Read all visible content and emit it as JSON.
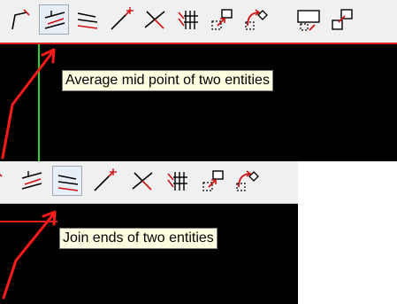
{
  "panels": [
    {
      "tooltip": "Average mid point of two entities",
      "tools": [
        {
          "icon": "polyline-corner-icon"
        },
        {
          "icon": "average-midpoint-icon"
        },
        {
          "icon": "join-ends-icon"
        },
        {
          "icon": "extend-line-icon"
        },
        {
          "icon": "trim-cross-icon"
        },
        {
          "icon": "break-multiple-icon"
        },
        {
          "icon": "move-box-icon"
        },
        {
          "icon": "rotate-box-icon"
        },
        {
          "icon": "box-select-icon"
        },
        {
          "icon": "copy-box-icon"
        }
      ]
    },
    {
      "tooltip": "Join ends of two entities",
      "tools": [
        {
          "icon": "polyline-corner-icon"
        },
        {
          "icon": "average-midpoint-icon"
        },
        {
          "icon": "join-ends-icon"
        },
        {
          "icon": "extend-line-icon"
        },
        {
          "icon": "trim-cross-icon"
        },
        {
          "icon": "break-multiple-icon"
        },
        {
          "icon": "move-box-icon"
        },
        {
          "icon": "rotate-box-icon"
        }
      ]
    }
  ],
  "colors": {
    "annotation_arrow": "#ff1a1a",
    "red_line": "#e0201a",
    "green_line": "#2ed12e",
    "tooltip_bg": "#ffffe1"
  }
}
